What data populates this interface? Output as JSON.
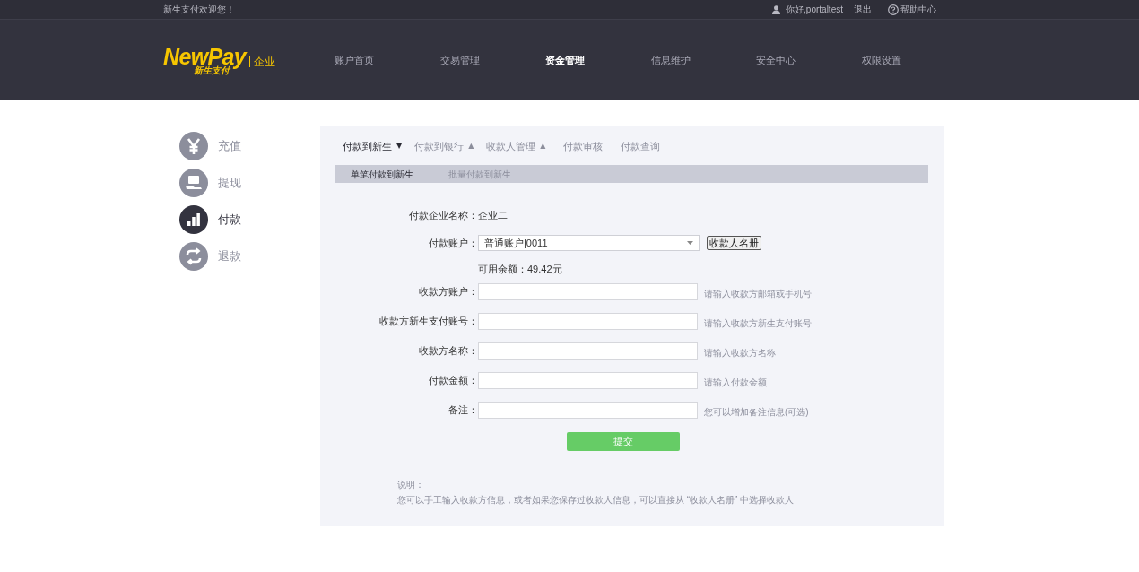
{
  "top_bar": {
    "welcome": "新生支付欢迎您！",
    "greeting": "你好,portaltest",
    "logout": "退出",
    "help": "帮助中心"
  },
  "header": {
    "logo": {
      "brand": "NewPay",
      "brand_sub": "新生支付",
      "tag": "企业"
    },
    "nav": [
      {
        "label": "账户首页",
        "selected": false
      },
      {
        "label": "交易管理",
        "selected": false
      },
      {
        "label": "资金管理",
        "selected": true
      },
      {
        "label": "信息维护",
        "selected": false
      },
      {
        "label": "安全中心",
        "selected": false
      },
      {
        "label": "权限设置",
        "selected": false
      }
    ]
  },
  "sidebar": {
    "items": [
      {
        "label": "充值",
        "selected": false
      },
      {
        "label": "提现",
        "selected": false
      },
      {
        "label": "付款",
        "selected": true
      },
      {
        "label": "退款",
        "selected": false
      }
    ]
  },
  "tabs": [
    {
      "label": "付款到新生",
      "selected": true,
      "caret": "▼"
    },
    {
      "label": "付款到银行",
      "selected": false,
      "caret": "▲"
    },
    {
      "label": "收款人管理",
      "selected": false,
      "caret": "▲"
    },
    {
      "label": "付款审核",
      "selected": false
    },
    {
      "label": "付款查询",
      "selected": false
    }
  ],
  "subtabs": [
    {
      "label": "单笔付款到新生",
      "selected": true
    },
    {
      "label": "批量付款到新生",
      "selected": false
    }
  ],
  "form": {
    "company": {
      "label": "付款企业名称：",
      "value": "企业二"
    },
    "account": {
      "label": "付款账户：",
      "value": "普通账户|0011",
      "roster_button": "收款人名册"
    },
    "balance": "可用余额：49.42元",
    "fields": [
      {
        "label": "收款方账户：",
        "hint": "请输入收款方邮箱或手机号"
      },
      {
        "label": "收款方新生支付账号：",
        "hint": "请输入收款方新生支付账号"
      },
      {
        "label": "收款方名称：",
        "hint": "请输入收款方名称"
      },
      {
        "label": "付款金额：",
        "hint": "请输入付款金额"
      },
      {
        "label": "备注：",
        "hint": "您可以增加备注信息(可选)"
      }
    ],
    "submit": "提交"
  },
  "notes": {
    "title": "说明：",
    "text": "您可以手工输入收款方信息，或者如果您保存过收款人信息，可以直接从 “收款人名册” 中选择收款人"
  }
}
